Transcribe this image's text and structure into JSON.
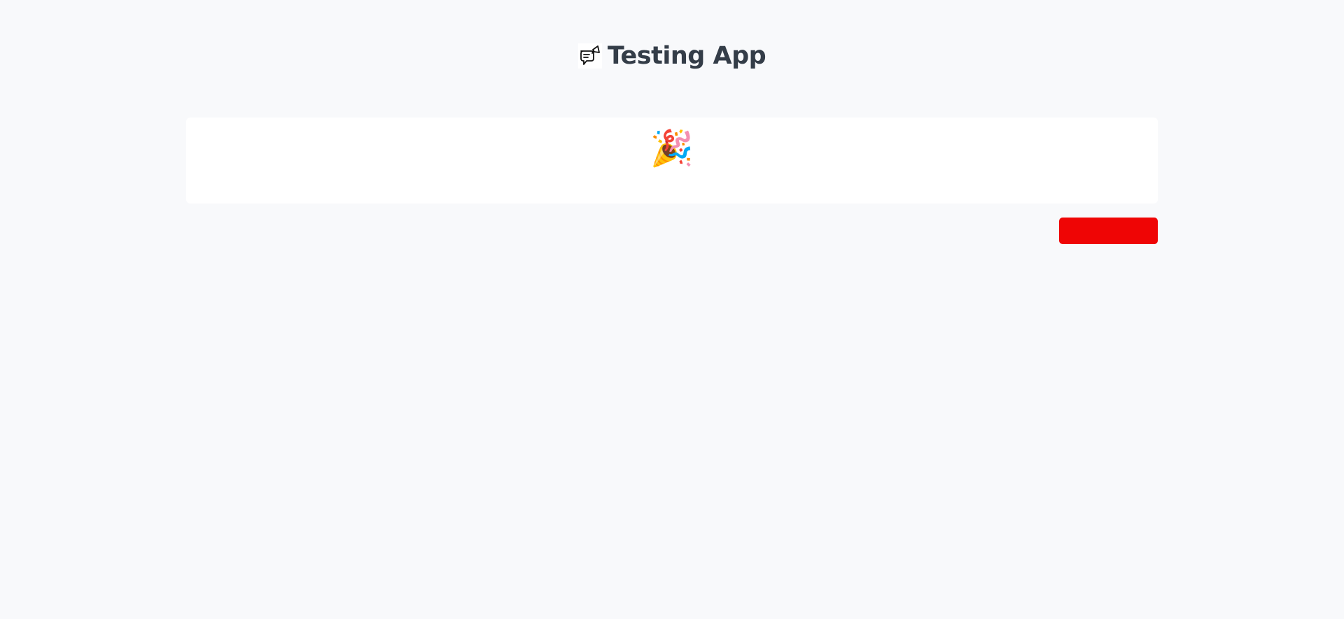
{
  "header": {
    "title": "Testing App",
    "logo_icon": "chat-megaphone-icon"
  },
  "card": {
    "emoji": "🎉",
    "emoji_icon": "party-popper-icon"
  },
  "action_button": {
    "label": "",
    "color": "#ef0505"
  },
  "colors": {
    "background": "#f8f9fb",
    "title": "#343d48"
  }
}
